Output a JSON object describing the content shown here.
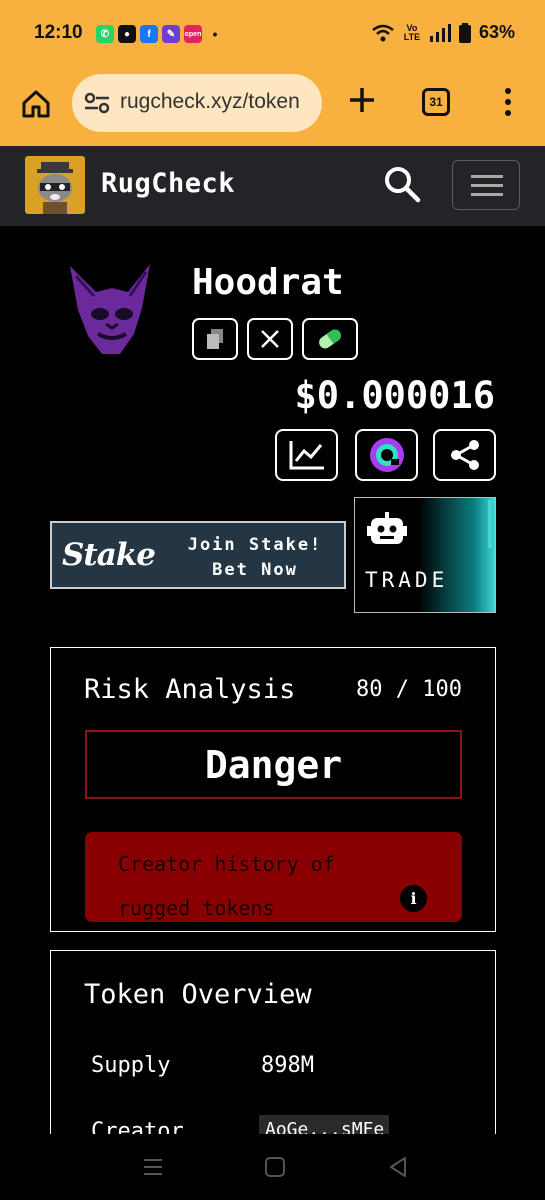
{
  "status_bar": {
    "time": "12:10",
    "apps": [
      {
        "icon": "whatsapp-icon",
        "color": "#25d366"
      },
      {
        "icon": "messages-icon",
        "color": "#111111"
      },
      {
        "icon": "facebook-icon",
        "color": "#1877f2"
      },
      {
        "icon": "app-icon",
        "color": "#6b3fd6"
      },
      {
        "icon": "open-app-icon",
        "color": "#e0245e"
      }
    ],
    "network": "Vo LTE",
    "battery": "63%"
  },
  "browser": {
    "url": "rugcheck.xyz/token",
    "tab_count": "31"
  },
  "site": {
    "brand": "RugCheck"
  },
  "token": {
    "name": "Hoodrat",
    "price": "$0.000016",
    "icon_buttons": [
      "copy-icon",
      "x-icon",
      "pill-icon"
    ],
    "action_buttons": [
      "chart-icon",
      "gecko-icon",
      "share-icon"
    ]
  },
  "ads": {
    "stake_logo": "Stake",
    "stake_line1": "Join Stake!",
    "stake_line2": "Bet Now",
    "trade_label": "TRADE"
  },
  "risk": {
    "title": "Risk Analysis",
    "score": "80 / 100",
    "level": "Danger",
    "alert": "Creator history of rugged tokens",
    "colors": {
      "danger_border": "#8a1414",
      "alert_bg": "#880000"
    }
  },
  "overview": {
    "title": "Token Overview",
    "rows": [
      {
        "label": "Supply",
        "value": "898M"
      },
      {
        "label": "Creator",
        "value": "AoGe...sMFe"
      }
    ]
  }
}
